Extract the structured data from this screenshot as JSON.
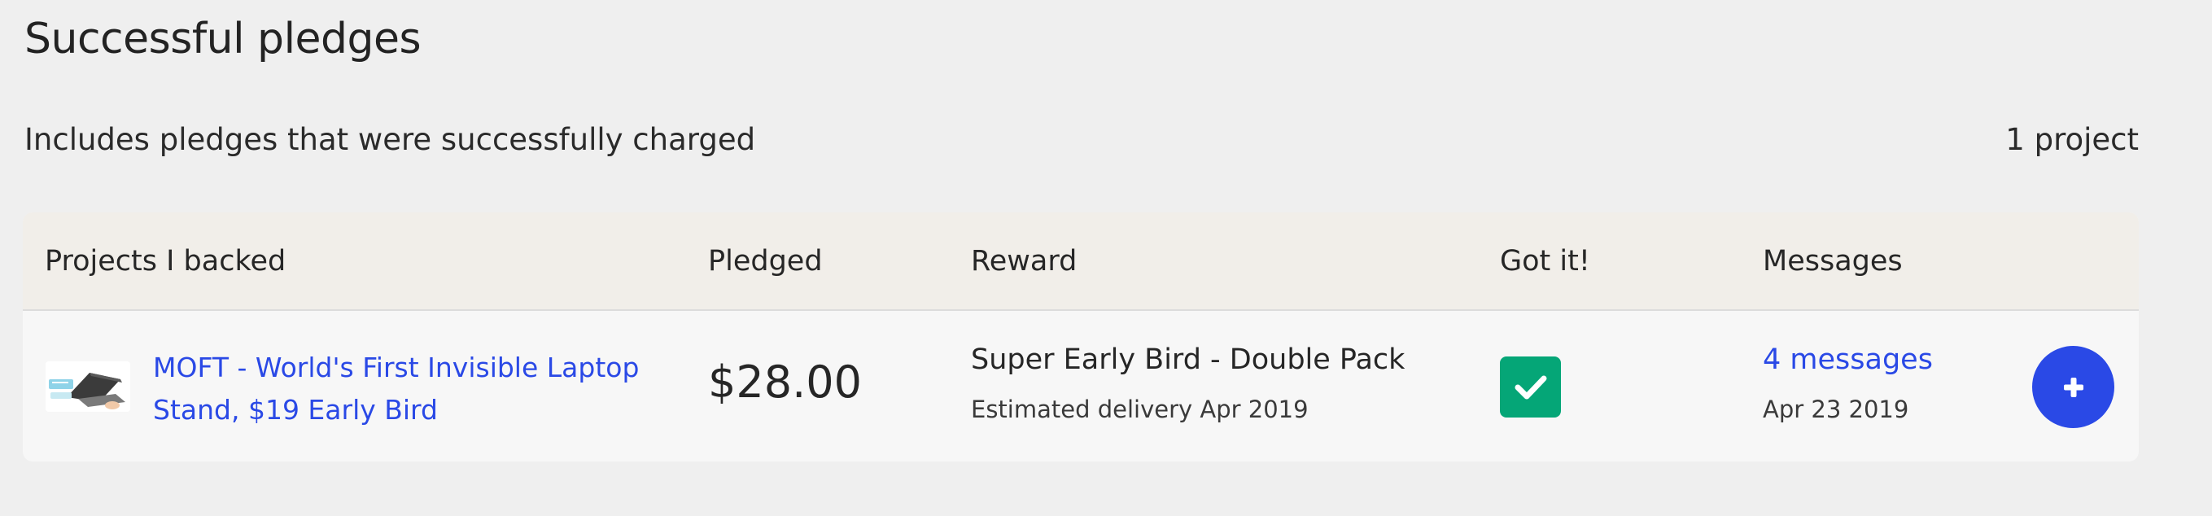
{
  "header": {
    "title": "Successful pledges",
    "subtitle": "Includes pledges that were successfully charged",
    "count": "1 project"
  },
  "table": {
    "columns": {
      "project": "Projects I backed",
      "pledged": "Pledged",
      "reward": "Reward",
      "got_it": "Got it!",
      "messages": "Messages"
    },
    "rows": [
      {
        "project_name": "MOFT - World's First Invisible Laptop Stand, $19 Early Bird",
        "thumbnail_icon": "laptop-stand-thumbnail",
        "pledged": "$28.00",
        "reward_title": "Super Early Bird - Double Pack",
        "reward_delivery": "Estimated delivery Apr 2019",
        "got_it_icon": "check-icon",
        "got_it_checked": true,
        "messages_link": "4 messages",
        "messages_date": "Apr 23 2019",
        "action_icon": "plus-icon"
      }
    ]
  },
  "colors": {
    "background": "#efefef",
    "header_bg": "#f1eee9",
    "row_bg": "#f7f7f7",
    "link": "#2a49e6",
    "check_green": "#05a677",
    "action_blue": "#2a49e6"
  }
}
